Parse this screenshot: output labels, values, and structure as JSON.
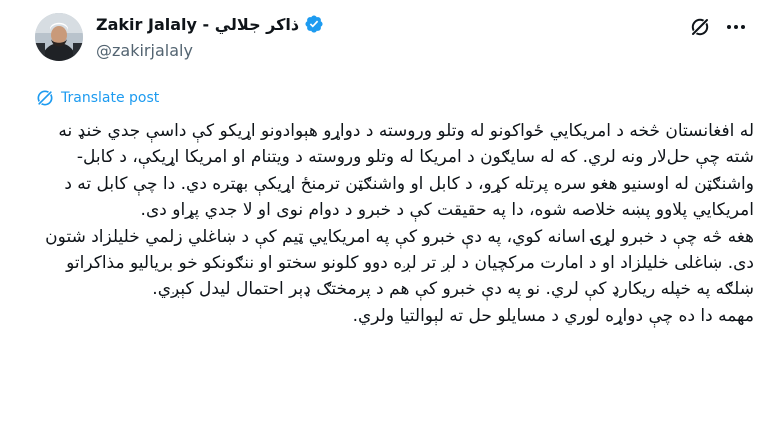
{
  "author": {
    "display_name": "Zakir Jalaly - ذاکر جلالي",
    "handle": "@zakirjalaly",
    "verified": true
  },
  "actions": {
    "translate_label": "Translate post"
  },
  "colors": {
    "accent": "#1d9bf0",
    "text": "#0f1419",
    "muted": "#536471"
  },
  "post": {
    "paragraphs": [
      "له افغانستان څخه د امریکايي ځواکونو له وتلو وروسته د دواړو هېوادونو اړیکو کې داسې جدي خنډ نه شته چې حل‌لار ونه لري. که له سایګون د امریکا له وتلو وروسته د ویتنام او امریکا اړیکې، د کابل-واشنګټن له اوسنیو هغو سره پرتله کړو، د کابل او واشنګټن ترمنځ اړیکې بهتره دي. دا چې کابل ته د امریکايي پلاوو پښه خلاصه شوه، دا په حقیقت کې د خبرو د دوام نوی او لا جدي پړاو دی.",
      "هغه څه چې د خبرو لړۍ اسانه کوي، په دې خبرو کې په امریکايي ټیم کې د ښاغلي زلمي خلیلزاد شتون دی. ښاغلی خلیلزاد او د امارت مرکچیان د لږ تر لږه دوو کلونو سختو او ننګونکو خو بریالیو مذاکراتو ښلګه په خپله ریکارډ کې لري. نو په دې خبرو کې هم د پرمختګ ډېر احتمال لیدل کېږي.",
      "مهمه دا ده چې دواړه لوري د مسایلو حل ته لېوالتیا ولري."
    ]
  }
}
